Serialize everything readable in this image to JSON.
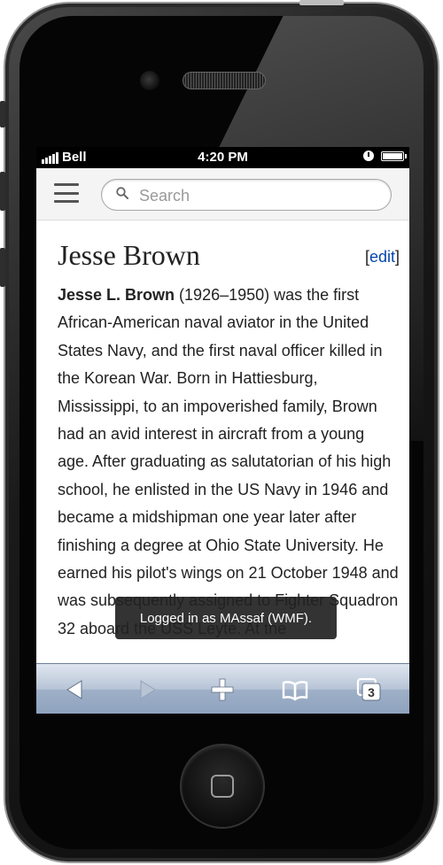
{
  "status_bar": {
    "carrier": "Bell",
    "time": "4:20 PM"
  },
  "search": {
    "placeholder": "Search"
  },
  "article": {
    "title": "Jesse Brown",
    "edit_open": "[",
    "edit_label": "edit",
    "edit_close": "]",
    "lead_bold": "Jesse L. Brown",
    "lead_text": " (1926–1950) was the first African-American naval aviator in the United States Navy, and the first naval officer killed in the Korean War. Born in Hattiesburg, Mississippi, to an impoverished family, Brown had an avid interest in aircraft from a young age. After graduating as salutatorian of his high school, he enlisted in the US Navy in 1946 and became a midshipman one year later after finishing a degree at Ohio State University. He earned his pilot's wings on 21 October 1948 and was subsequently assigned to Fighter Squadron 32 aboard the USS Leyte. At the"
  },
  "toast": {
    "message": "Logged in as MAssaf (WMF)."
  },
  "toolbar": {
    "tabs_count": "3",
    "back_icon": "back-arrow-icon",
    "forward_icon": "forward-arrow-icon",
    "add_icon": "plus-icon",
    "bookmarks_icon": "bookmarks-icon",
    "tabs_icon": "tabs-icon"
  },
  "colors": {
    "link": "#0645ad",
    "toast_bg": "#222222",
    "toolbar_top": "#dfe6f0",
    "toolbar_bottom": "#8ea2bd"
  }
}
